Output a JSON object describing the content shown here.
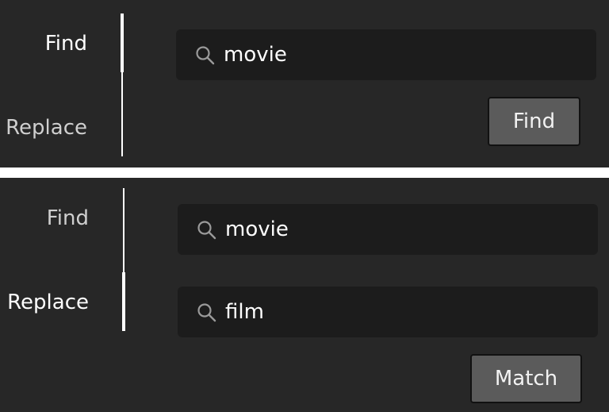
{
  "top_panel": {
    "tabs": {
      "find": "Find",
      "replace": "Replace"
    },
    "active_tab": "find",
    "find_input": {
      "value": "movie",
      "icon": "search-icon"
    },
    "action_button": "Find"
  },
  "bottom_panel": {
    "tabs": {
      "find": "Find",
      "replace": "Replace"
    },
    "active_tab": "replace",
    "find_input": {
      "value": "movie",
      "icon": "search-icon"
    },
    "replace_input": {
      "value": "film",
      "icon": "search-icon"
    },
    "action_button": "Match"
  },
  "colors": {
    "panel_bg": "#272727",
    "field_bg": "#1c1c1c",
    "button_bg": "#5b5b5b",
    "text": "#ffffff"
  }
}
